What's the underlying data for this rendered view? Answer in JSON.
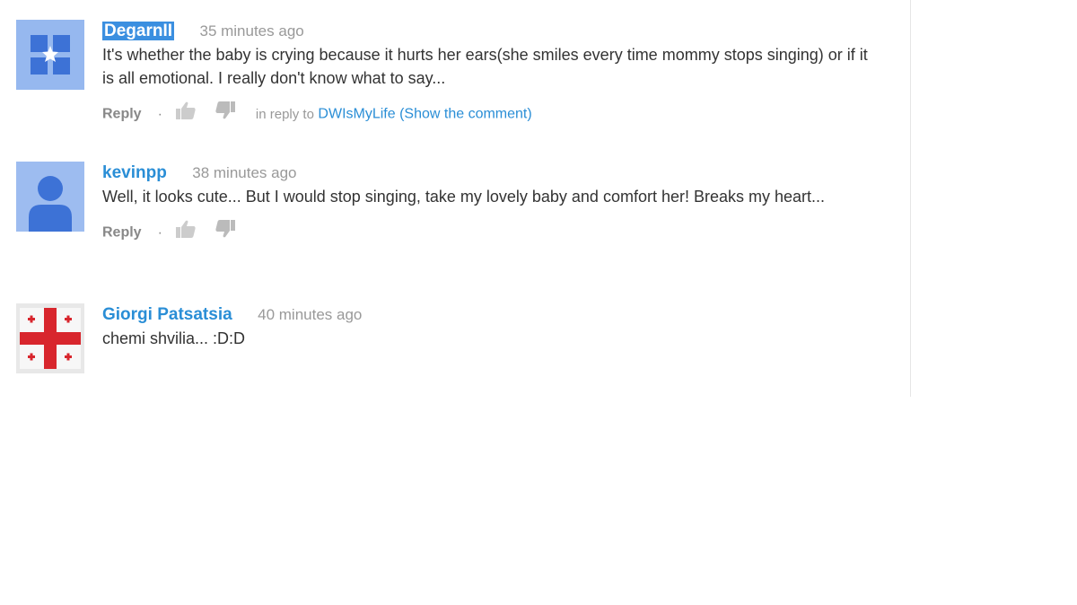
{
  "comments": [
    {
      "author": "DegarnII",
      "time": "35 minutes ago",
      "text": "It's whether the baby is crying because it hurts her ears(she smiles every time mommy stops singing) or if it is all emotional. I really don't know what to say...",
      "reply_label": "Reply",
      "separator": "·",
      "in_reply_to_prefix": "in reply to",
      "in_reply_to_user": "DWIsMyLife",
      "show_comment_label": "(Show the comment)",
      "avatar_icon": "blue-star-avatar-icon"
    },
    {
      "author": "kevinpp",
      "time": "38 minutes ago",
      "text": "Well, it looks cute... But I would stop singing, take my lovely baby and comfort her! Breaks my heart...",
      "reply_label": "Reply",
      "separator": "·",
      "avatar_icon": "default-user-avatar-icon"
    },
    {
      "author": "Giorgi Patsatsia",
      "time": "40 minutes ago",
      "text": "chemi shvilia... :D:D",
      "avatar_icon": "georgia-flag-avatar-icon"
    }
  ],
  "colors": {
    "link": "#2a8ed6",
    "meta": "#999999",
    "text": "#333333",
    "selection": "#3b8fe0"
  }
}
